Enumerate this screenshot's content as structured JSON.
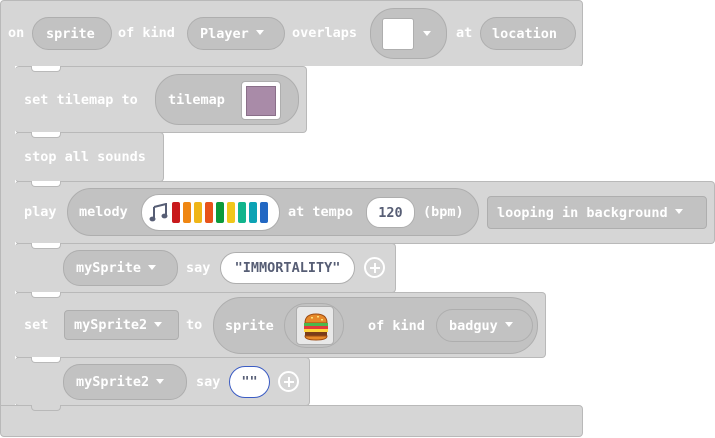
{
  "event": {
    "on": "on",
    "sprite_param": "sprite",
    "of_kind": "of kind",
    "kind_value": "Player",
    "overlaps": "overlaps",
    "tile_color": "#ffffff",
    "at": "at",
    "location_param": "location"
  },
  "set_tilemap": {
    "label": "set tilemap to",
    "tilemap_label": "tilemap",
    "tilemap_color": "#a98ba8"
  },
  "stop_sounds": {
    "label": "stop all sounds"
  },
  "play": {
    "play": "play",
    "melody": "melody",
    "melody_colors": [
      "#c8191c",
      "#ef8612",
      "#efb618",
      "#e7531b",
      "#0b9a3b",
      "#f0c71b",
      "#11b48c",
      "#0ca3b4",
      "#2268c3"
    ],
    "at_tempo": "at tempo",
    "tempo": "120",
    "bpm": "(bpm)",
    "mode": "looping in background"
  },
  "say1": {
    "sprite": "mySprite",
    "say": "say",
    "text": "IMMORTALITY"
  },
  "set_sprite": {
    "set": "set",
    "var": "mySprite2",
    "to": "to",
    "sprite": "sprite",
    "image": "burger-icon",
    "of_kind": "of kind",
    "kind_value": "badguy"
  },
  "say2": {
    "sprite": "mySprite2",
    "say": "say",
    "text": ""
  },
  "colors": {
    "block": "#d6d6d6",
    "block_border": "#b9b9b9",
    "slot": "#c2c2c2"
  }
}
